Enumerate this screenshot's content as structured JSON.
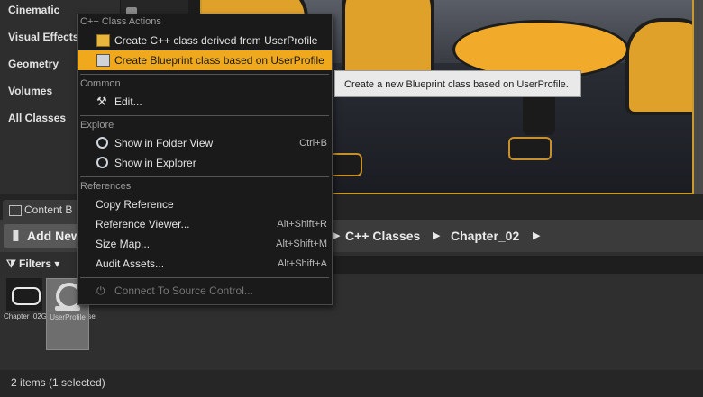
{
  "modes_panel": {
    "items": [
      "Cinematic",
      "Visual Effects",
      "Geometry",
      "Volumes",
      "All Classes"
    ]
  },
  "content_browser": {
    "tab_label": "Content B",
    "add_new_label": "Add New",
    "breadcrumbs": [
      "C++ Classes",
      "Chapter_02"
    ],
    "filters_label": "Filters",
    "assets": [
      {
        "label": "Chapter_02GameModeBase",
        "selected": false,
        "icon": "gamepad-icon"
      },
      {
        "label": "UserProfile",
        "selected": true,
        "icon": "actor-class-icon"
      }
    ],
    "status": "2 items (1 selected)"
  },
  "context_menu": {
    "sections": [
      {
        "header": "C++ Class Actions",
        "items": [
          {
            "label": "Create C++ class derived from UserProfile",
            "icon": "cpp-class-icon"
          },
          {
            "label": "Create Blueprint class based on UserProfile",
            "icon": "blueprint-class-icon",
            "highlighted": true
          }
        ]
      },
      {
        "header": "Common",
        "items": [
          {
            "label": "Edit...",
            "icon": "hammer-icon"
          }
        ]
      },
      {
        "header": "Explore",
        "items": [
          {
            "label": "Show in Folder View",
            "icon": "magnifier-icon",
            "shortcut": "Ctrl+B"
          },
          {
            "label": "Show in Explorer",
            "icon": "magnifier-icon"
          }
        ]
      },
      {
        "header": "References",
        "items": [
          {
            "label": "Copy Reference"
          },
          {
            "label": "Reference Viewer...",
            "shortcut": "Alt+Shift+R"
          },
          {
            "label": "Size Map...",
            "shortcut": "Alt+Shift+M"
          },
          {
            "label": "Audit Assets...",
            "shortcut": "Alt+Shift+A"
          }
        ]
      },
      {
        "items": [
          {
            "label": "Connect To Source Control...",
            "icon": "plug-icon",
            "disabled": true
          }
        ]
      }
    ]
  },
  "tooltip": "Create a new Blueprint class based on UserProfile.",
  "colors": {
    "highlight": "#f0a91c",
    "menu_bg": "#1a1a1a",
    "tooltip_bg": "#e9e9e9"
  }
}
